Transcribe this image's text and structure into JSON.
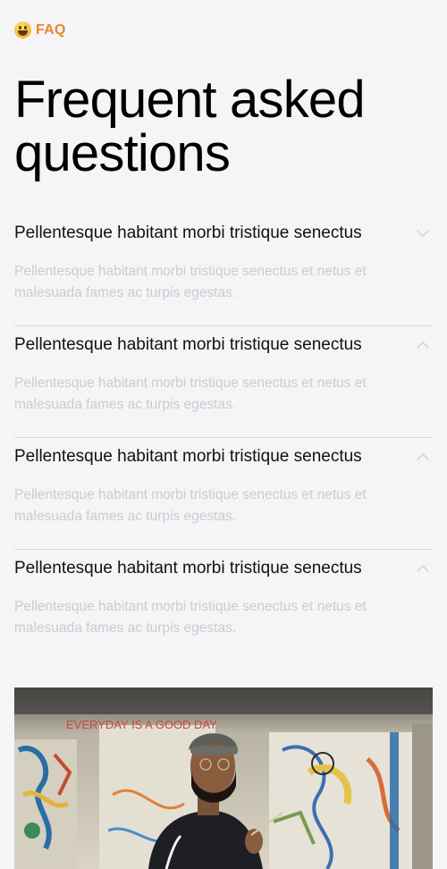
{
  "header": {
    "eyebrow_icon": "grinning-face-emoji",
    "eyebrow_label": "FAQ",
    "eyebrow_color": "#e9862c",
    "title": "Frequent asked questions"
  },
  "faq": {
    "items": [
      {
        "question": "Pellentesque habitant morbi tristique senectus",
        "answer": "Pellentesque habitant morbi tristique senectus et netus et malesuada fames ac turpis egestas.",
        "chevron": "chevron-down-icon"
      },
      {
        "question": "Pellentesque habitant morbi tristique senectus",
        "answer": "Pellentesque habitant morbi tristique senectus et netus et malesuada fames ac turpis egestas.",
        "chevron": "chevron-up-icon"
      },
      {
        "question": "Pellentesque habitant morbi tristique senectus",
        "answer": "Pellentesque habitant morbi tristique senectus et netus et malesuada fames ac turpis egestas.",
        "chevron": "chevron-up-icon"
      },
      {
        "question": "Pellentesque habitant morbi tristique senectus",
        "answer": "Pellentesque habitant morbi tristique senectus et netus et malesuada fames ac turpis egestas.",
        "chevron": "chevron-up-icon"
      }
    ]
  },
  "photo": {
    "subject": "artist-in-front-of-graffiti-canvas",
    "wall_text": "EVERYDAY IS A GOOD DAY"
  }
}
